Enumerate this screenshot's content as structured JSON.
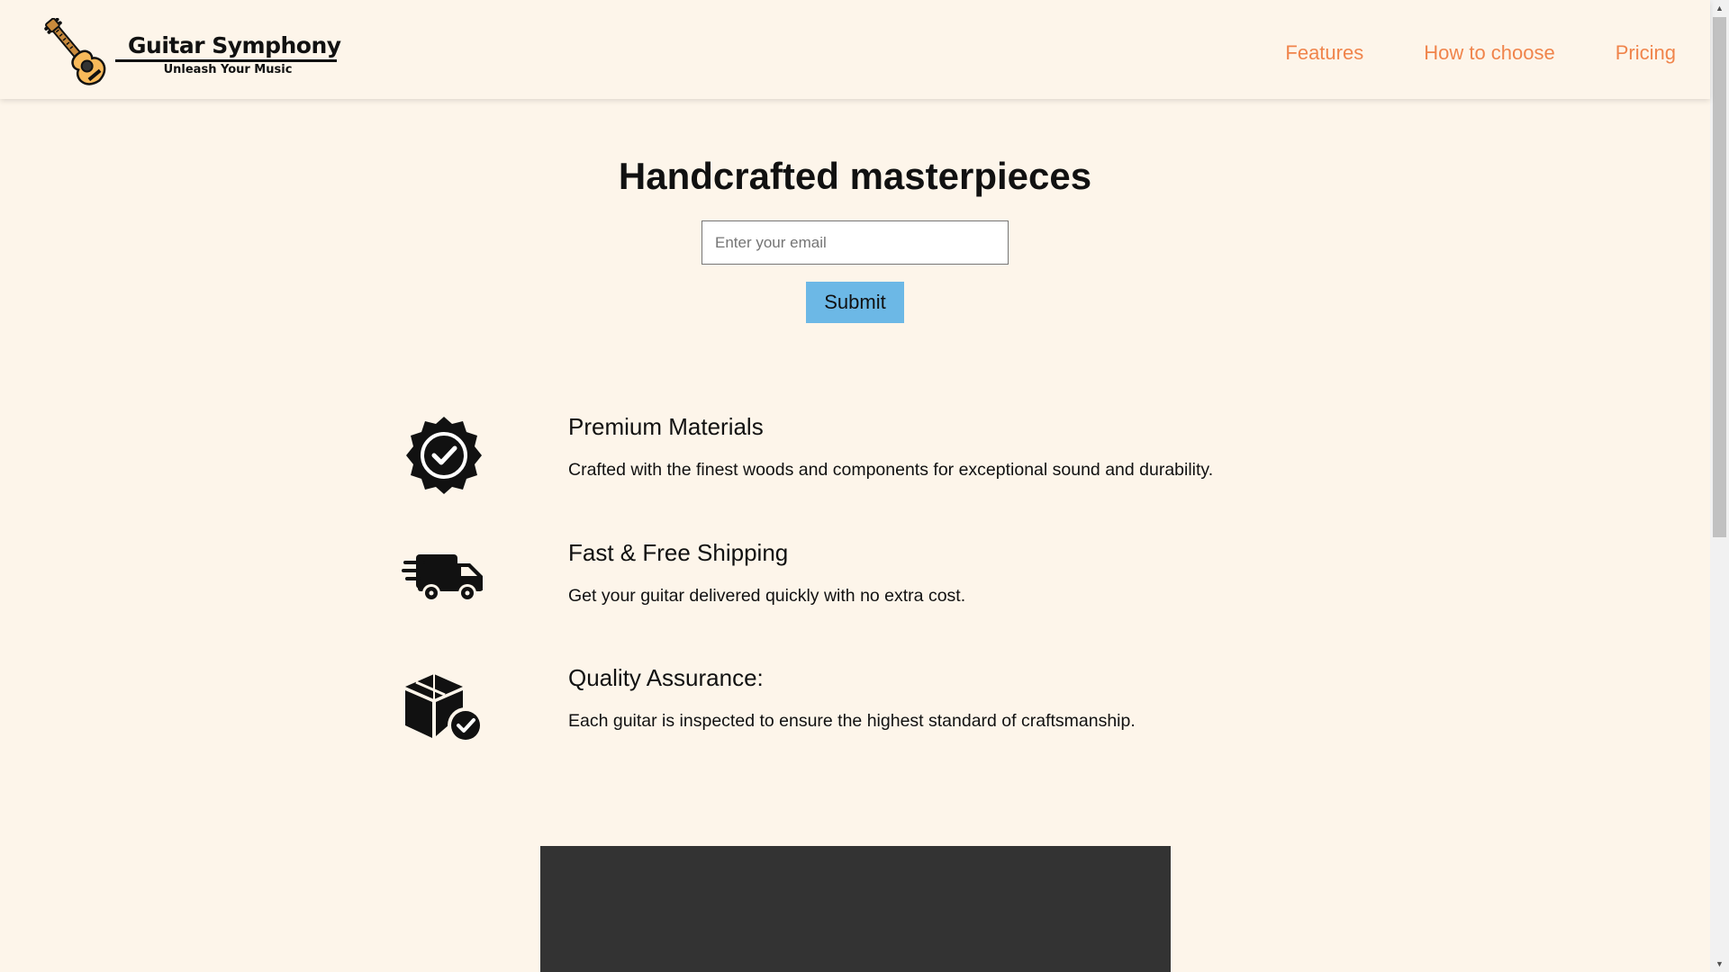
{
  "header": {
    "brand_title": "Guitar Symphony",
    "brand_tagline": "Unleash Your Music",
    "logo_icon": "acoustic-guitar-icon",
    "nav": [
      {
        "label": "Features"
      },
      {
        "label": "How to choose"
      },
      {
        "label": "Pricing"
      }
    ]
  },
  "hero": {
    "title": "Handcrafted masterpieces",
    "email_placeholder": "Enter your email",
    "email_value": "",
    "submit_label": "Submit"
  },
  "features": [
    {
      "icon": "verified-badge-icon",
      "title": "Premium Materials",
      "description": "Crafted with the finest woods and components for exceptional sound and durability."
    },
    {
      "icon": "delivery-truck-icon",
      "title": "Fast & Free Shipping",
      "description": "Get your guitar delivered quickly with no extra cost."
    },
    {
      "icon": "box-check-icon",
      "title": "Quality Assurance:",
      "description": "Each guitar is inspected to ensure the highest standard of craftsmanship."
    }
  ],
  "colors": {
    "page_background": "#fdf5ea",
    "nav_link": "#f0844b",
    "submit_button": "#6cb8e6",
    "video_block": "#333333",
    "text": "#111111"
  }
}
